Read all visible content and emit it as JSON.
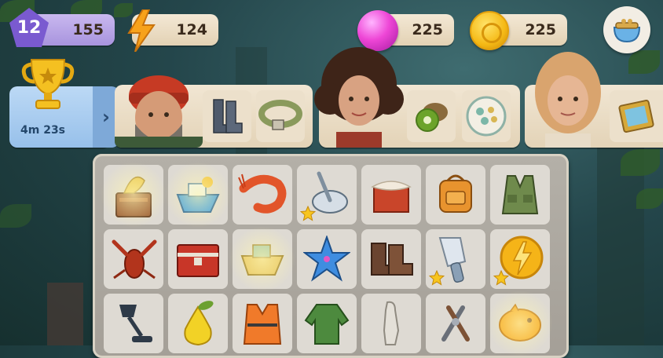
{
  "resources": {
    "level": "12",
    "xp": "155",
    "energy": "124",
    "gems": "225",
    "coins": "225"
  },
  "event": {
    "timer": "4m 23s"
  },
  "orders": [
    {
      "character": "fisherman",
      "items": [
        "rubber-boots",
        "canvas-belt"
      ]
    },
    {
      "character": "curly-haired-woman",
      "items": [
        "kiwi",
        "decorated-plate"
      ]
    },
    {
      "character": "blonde-woman",
      "items": [
        "picture-frame"
      ]
    }
  ],
  "board": {
    "rows": [
      [
        "wooden-table-generator",
        "boat-toy",
        "shrimp",
        "pushpin",
        "cheese-crate",
        "backpack",
        "vest"
      ],
      [
        "lobster",
        "red-chest",
        "boat-golden",
        "starfish",
        "hiking-boots",
        "knife",
        "energy-coin"
      ],
      [
        "desk-lamp",
        "pear",
        "life-jacket",
        "green-jacket",
        "statue",
        "pliers",
        "piggy-bank"
      ]
    ],
    "starred": [
      "pushpin",
      "knife",
      "energy-coin"
    ]
  },
  "colors": {
    "level_badge": "#7a5ad0",
    "timer_card": "#97c0ea",
    "pill": "#e3d2b4",
    "board": "#a49f97",
    "cell": "#dedad3"
  }
}
